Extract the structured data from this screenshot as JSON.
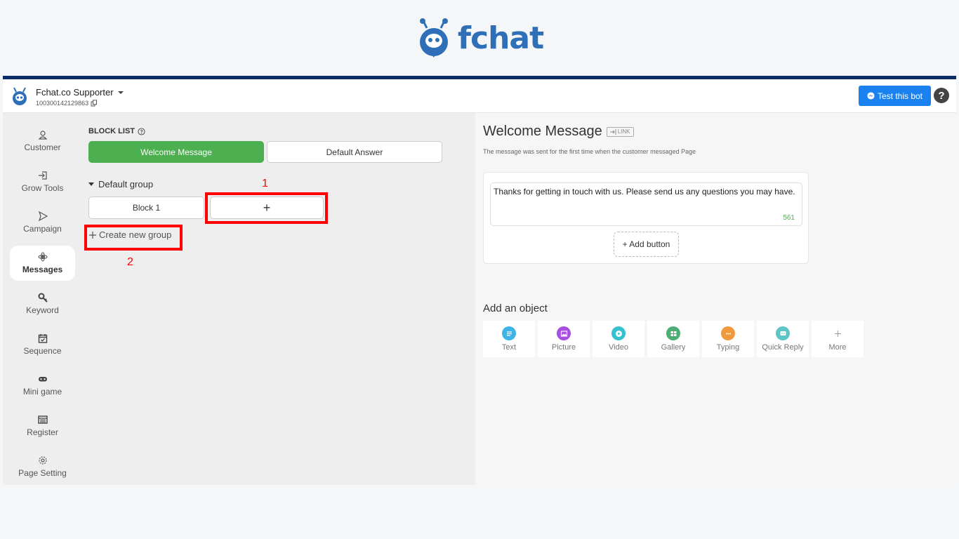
{
  "brand": {
    "name": "fchat"
  },
  "topbar": {
    "page_name": "Fchat.co Supporter",
    "page_id": "100300142129863",
    "test_button": "Test this bot",
    "help": "?"
  },
  "sidebar": {
    "items": [
      {
        "label": "Customer",
        "icon": "user-icon"
      },
      {
        "label": "Grow Tools",
        "icon": "login-icon"
      },
      {
        "label": "Campaign",
        "icon": "send-icon"
      },
      {
        "label": "Messages",
        "icon": "messages-icon",
        "active": true
      },
      {
        "label": "Keyword",
        "icon": "key-icon"
      },
      {
        "label": "Sequence",
        "icon": "calendar-check-icon"
      },
      {
        "label": "Mini game",
        "icon": "gamepad-icon"
      },
      {
        "label": "Register",
        "icon": "list-icon"
      },
      {
        "label": "Page Setting",
        "icon": "gear-icon"
      }
    ]
  },
  "blocklist": {
    "title": "BLOCK LIST",
    "tabs": {
      "welcome": "Welcome Message",
      "default": "Default Answer"
    },
    "group": "Default group",
    "blocks": [
      "Block 1"
    ],
    "add_block": "+",
    "create_group": "Create new group",
    "annotations": {
      "one": "1",
      "two": "2"
    }
  },
  "editor": {
    "title": "Welcome Message",
    "link_tag": "LINK",
    "description": "The message was sent for the first time when the customer messaged Page",
    "message": "Thanks for getting in touch with us. Please send us any questions you may have.",
    "char_count": "561",
    "add_button": "+ Add button",
    "objects_title": "Add an object",
    "objects": [
      {
        "label": "Text",
        "icon": "text-icon",
        "color": "#3db3e8"
      },
      {
        "label": "Picture",
        "icon": "picture-icon",
        "color": "#a84ee0"
      },
      {
        "label": "Video",
        "icon": "video-icon",
        "color": "#35c1cf"
      },
      {
        "label": "Gallery",
        "icon": "gallery-icon",
        "color": "#4cae73"
      },
      {
        "label": "Typing",
        "icon": "typing-icon",
        "color": "#f09a3e"
      },
      {
        "label": "Quick Reply",
        "icon": "quick-reply-icon",
        "color": "#5fc4c4"
      },
      {
        "label": "More",
        "icon": "plus-icon",
        "color": "#999999"
      }
    ]
  },
  "colors": {
    "brand": "#2f6fb8",
    "accent_green": "#4caf50",
    "primary_blue": "#1a82f0",
    "navy_bar": "#0b2e6b",
    "highlight": "#ff0000"
  }
}
